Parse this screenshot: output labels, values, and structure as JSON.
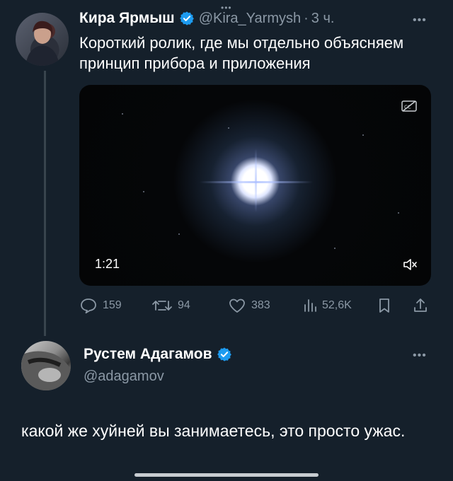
{
  "tweet1": {
    "author_name": "Кира Ярмыш",
    "handle": "@Kira_Yarmysh",
    "separator": "·",
    "time": "3 ч.",
    "text": "Короткий ролик, где мы отдельно объясняем принцип прибора и приложения",
    "media": {
      "duration": "1:21"
    },
    "actions": {
      "replies": "159",
      "retweets": "94",
      "likes": "383",
      "views": "52,6K"
    }
  },
  "tweet2": {
    "author_name": "Рустем Адагамов",
    "handle": "@adagamov",
    "text": "какой же хуйней вы занимаетесь, это просто ужас."
  },
  "colors": {
    "background": "#15202b",
    "secondary_text": "#8b98a5",
    "verified_blue": "#1d9bf0"
  }
}
